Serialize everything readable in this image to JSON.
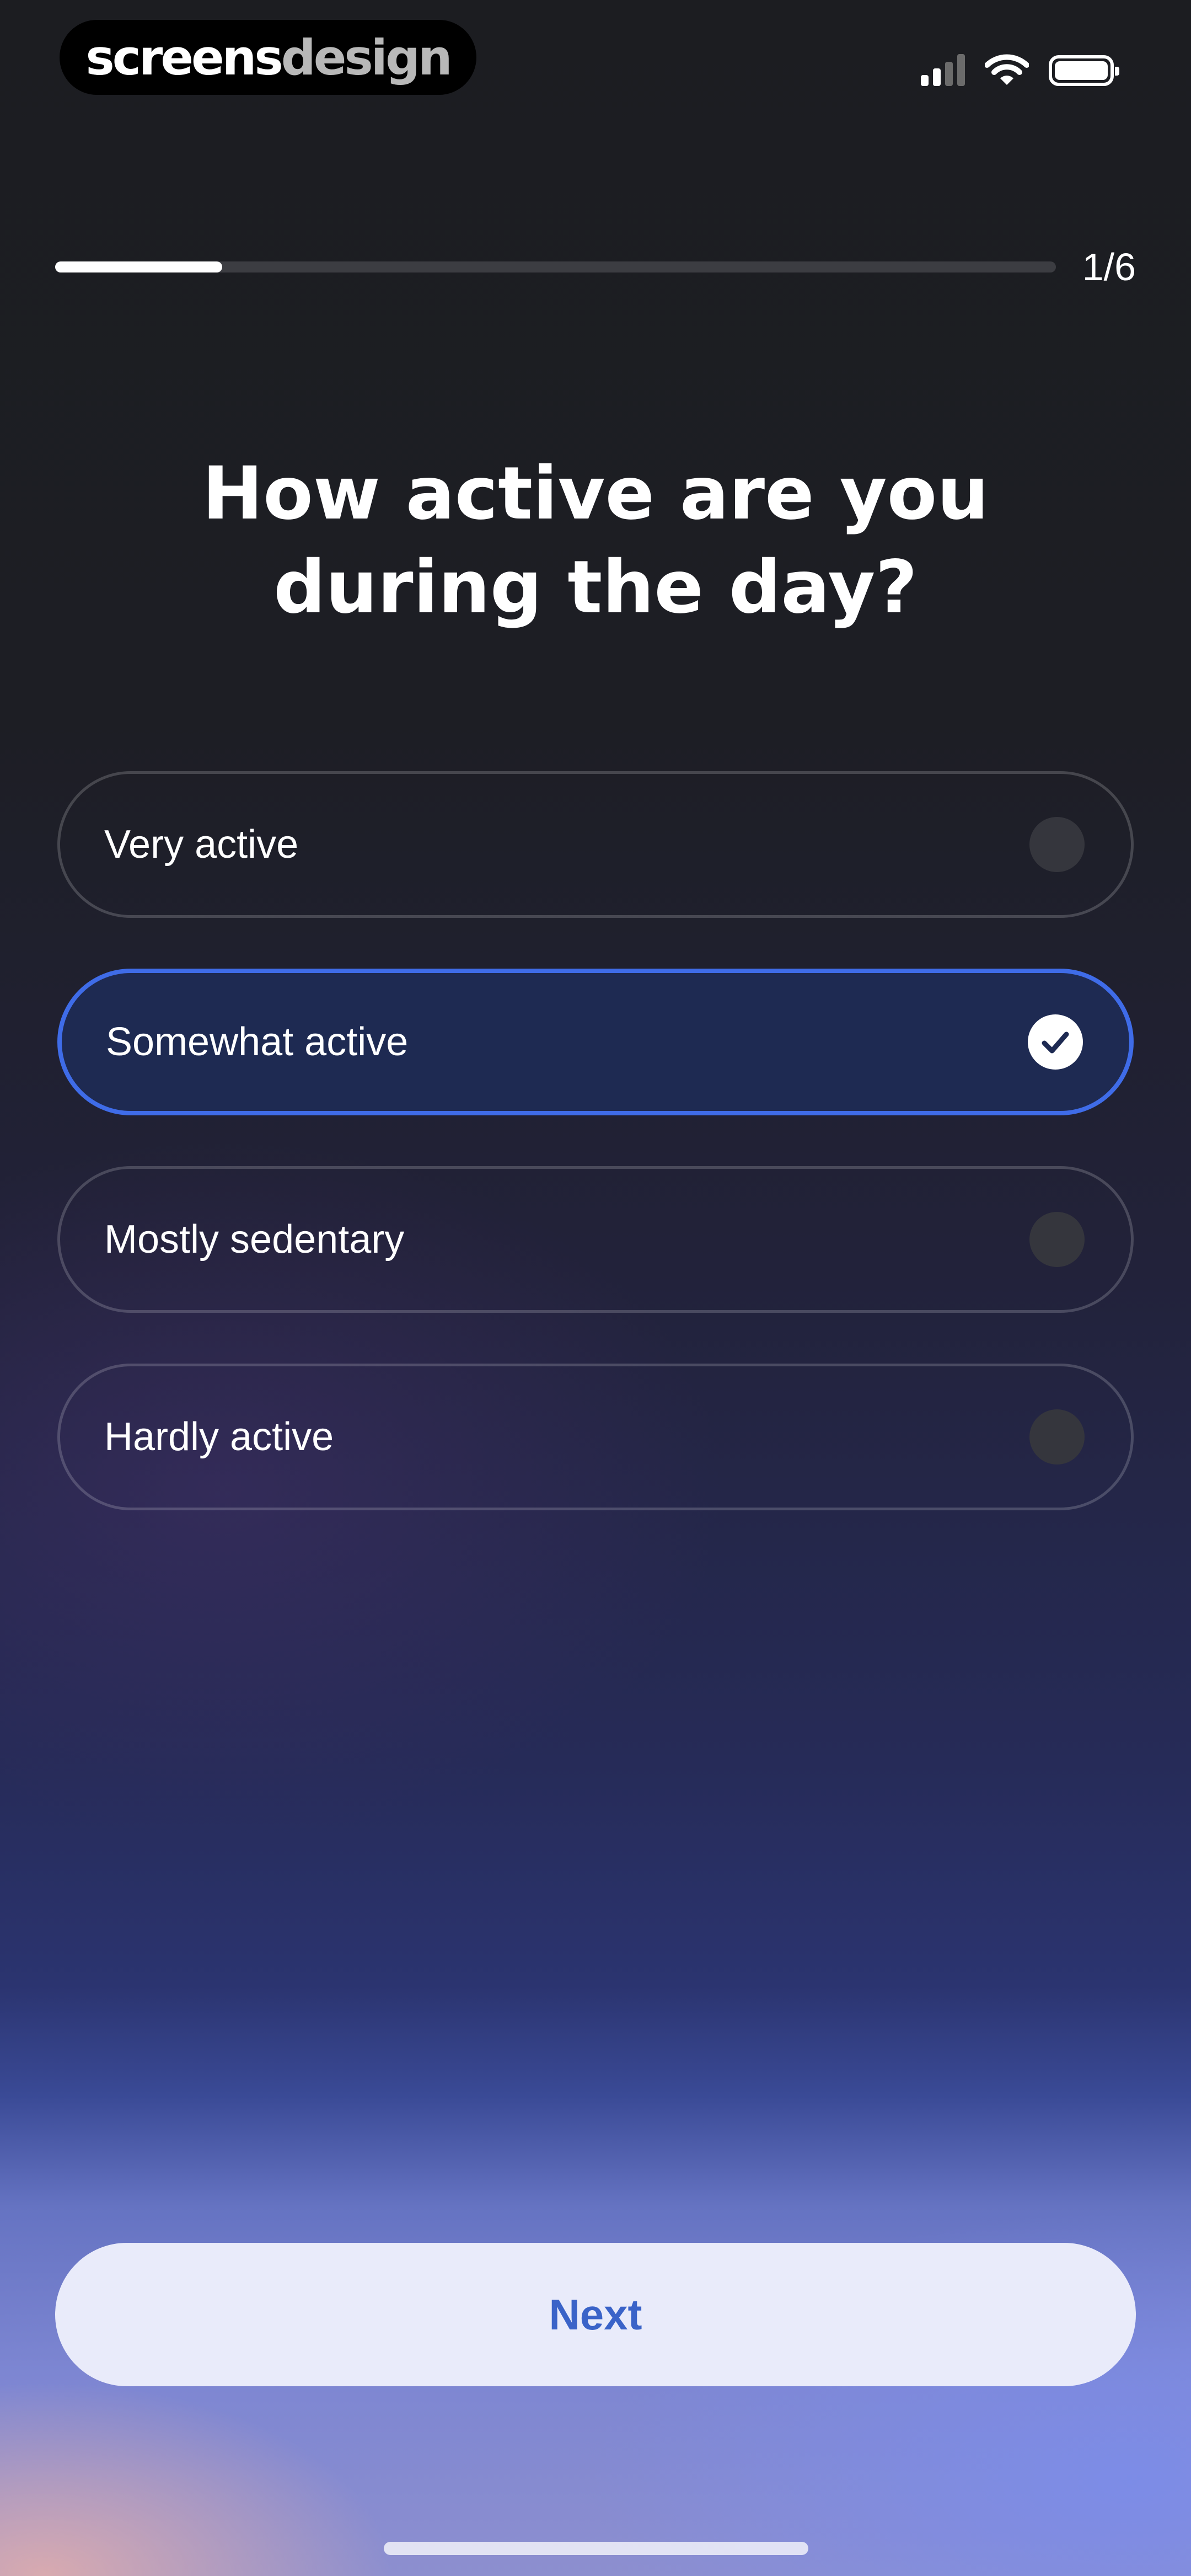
{
  "brand": {
    "part1": "screens",
    "part2": "design"
  },
  "status_bar": {
    "signal_icon": "cellular-signal-icon",
    "wifi_icon": "wifi-icon",
    "battery_icon": "battery-icon"
  },
  "progress": {
    "label": "1/6",
    "fraction": 0.167
  },
  "question": {
    "title": "How active are you during the day?"
  },
  "options": [
    {
      "label": "Very active",
      "selected": false
    },
    {
      "label": "Somewhat active",
      "selected": true
    },
    {
      "label": "Mostly sedentary",
      "selected": false
    },
    {
      "label": "Hardly active",
      "selected": false
    }
  ],
  "next_button": {
    "label": "Next"
  },
  "colors": {
    "accent": "#3f6ce8",
    "selected_background": "#1e2a52",
    "button_text": "#3a63c8",
    "button_background": "#e9ebfa"
  }
}
